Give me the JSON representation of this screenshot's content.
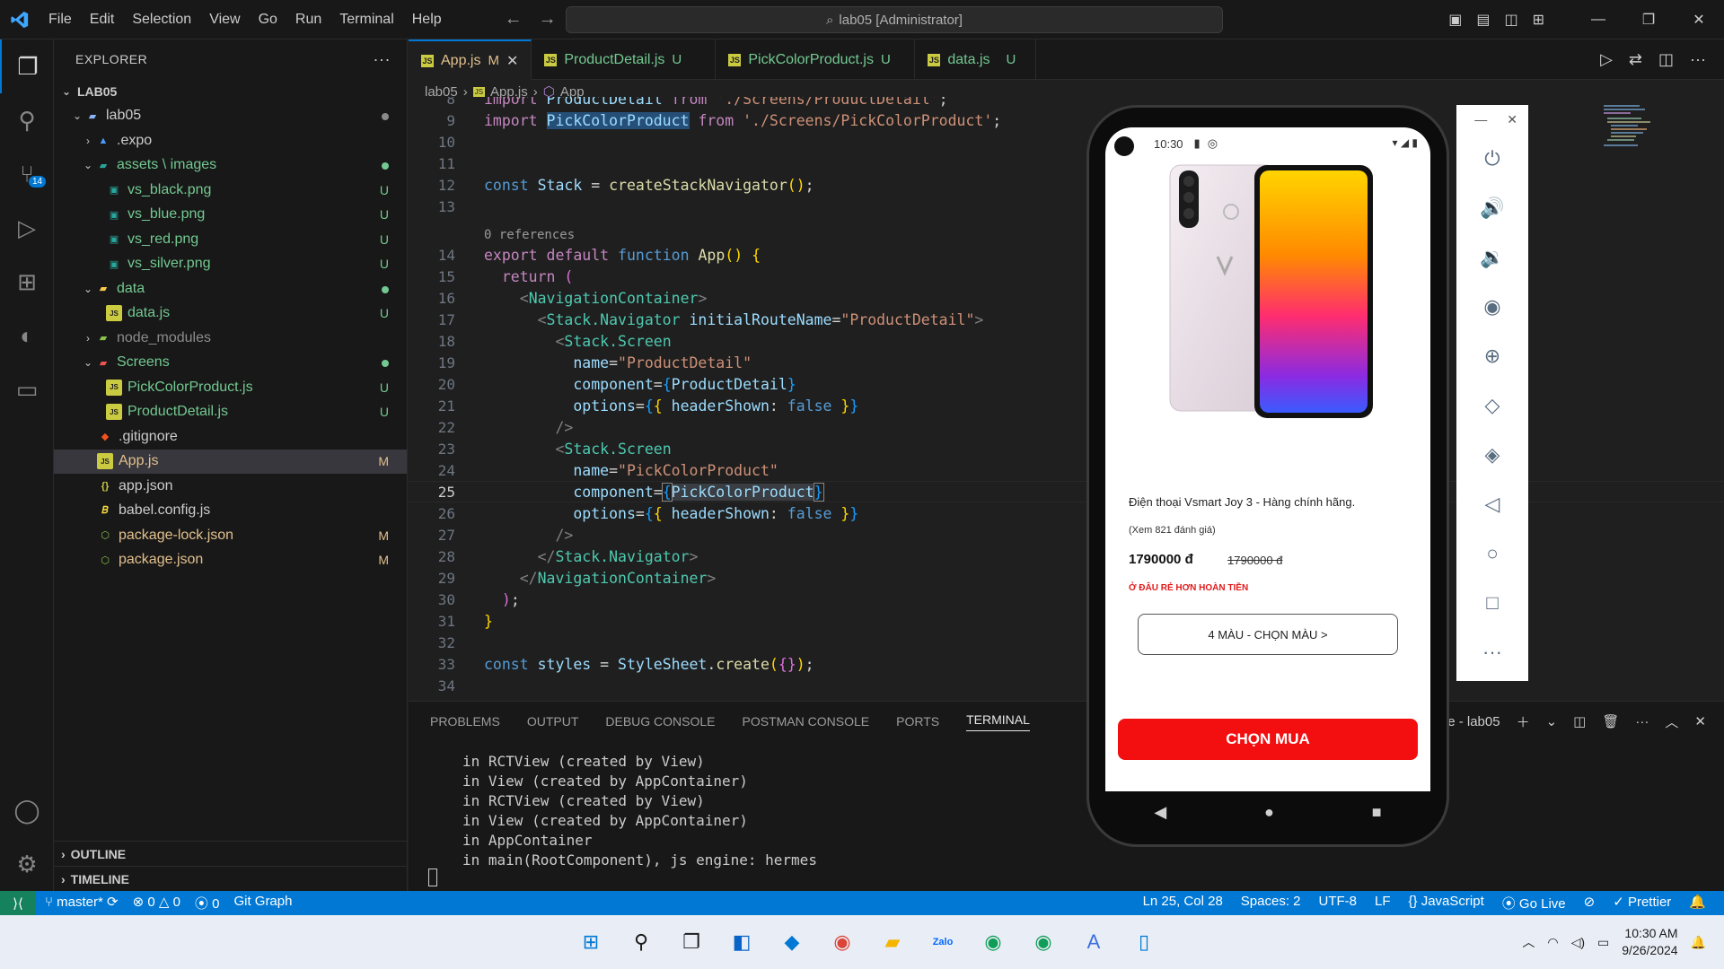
{
  "titlebar": {
    "menu": [
      "File",
      "Edit",
      "Selection",
      "View",
      "Go",
      "Run",
      "Terminal",
      "Help"
    ],
    "search": "lab05 [Administrator]"
  },
  "activity": {
    "scm_badge": "14"
  },
  "sidebar": {
    "title": "EXPLORER",
    "root": "LAB05",
    "items": [
      {
        "label": "lab05",
        "status": "dot"
      },
      {
        "label": ".expo",
        "status": ""
      },
      {
        "label": "assets \\ images",
        "status": "dot"
      },
      {
        "label": "vs_black.png",
        "status": "U"
      },
      {
        "label": "vs_blue.png",
        "status": "U"
      },
      {
        "label": "vs_red.png",
        "status": "U"
      },
      {
        "label": "vs_silver.png",
        "status": "U"
      },
      {
        "label": "data",
        "status": "dot"
      },
      {
        "label": "data.js",
        "status": "U"
      },
      {
        "label": "node_modules",
        "status": ""
      },
      {
        "label": "Screens",
        "status": "dot"
      },
      {
        "label": "PickColorProduct.js",
        "status": "U"
      },
      {
        "label": "ProductDetail.js",
        "status": "U"
      },
      {
        "label": ".gitignore",
        "status": ""
      },
      {
        "label": "App.js",
        "status": "M"
      },
      {
        "label": "app.json",
        "status": ""
      },
      {
        "label": "babel.config.js",
        "status": ""
      },
      {
        "label": "package-lock.json",
        "status": "M"
      },
      {
        "label": "package.json",
        "status": "M"
      }
    ],
    "outline": "OUTLINE",
    "timeline": "TIMELINE"
  },
  "tabs": [
    {
      "label": "App.js",
      "mod": "M"
    },
    {
      "label": "ProductDetail.js",
      "mod": "U"
    },
    {
      "label": "PickColorProduct.js",
      "mod": "U"
    },
    {
      "label": "data.js",
      "mod": "U"
    }
  ],
  "breadcrumb": [
    "lab05",
    "App.js",
    "App"
  ],
  "code": {
    "line8": "import ProductDetail from './Screens/ProductDetail';",
    "refs": "0 references",
    "lines": [
      "8",
      "9",
      "10",
      "11",
      "12",
      "13",
      "14",
      "15",
      "16",
      "17",
      "18",
      "19",
      "20",
      "21",
      "22",
      "23",
      "24",
      "25",
      "26",
      "27",
      "28",
      "29",
      "30",
      "31",
      "32",
      "33",
      "34"
    ]
  },
  "panel": {
    "tabs": [
      "PROBLEMS",
      "OUTPUT",
      "DEBUG CONSOLE",
      "POSTMAN CONSOLE",
      "PORTS",
      "TERMINAL"
    ],
    "terminal_name": "node - lab05",
    "terminal_lines": [
      "in RCTView (created by View)",
      "in View (created by AppContainer)",
      "in RCTView (created by View)",
      "in View (created by AppContainer)",
      "in AppContainer",
      "in main(RootComponent), js engine: hermes"
    ]
  },
  "statusbar": {
    "branch": "master*",
    "errors": "0",
    "warnings": "0",
    "ports": "0",
    "gitgraph": "Git Graph",
    "position": "Ln 25, Col 28",
    "spaces": "Spaces: 2",
    "encoding": "UTF-8",
    "eol": "LF",
    "language": "JavaScript",
    "golive": "Go Live",
    "prettier": "Prettier"
  },
  "phone": {
    "time": "10:30",
    "name": "Điện thoại Vsmart Joy 3 - Hàng chính hãng.",
    "reviews": "(Xem 821 đánh giá)",
    "price": "1790000 đ",
    "old_price": "1790000 đ",
    "refund": "Ở ĐÂU RẺ HƠN HOÀN TIỀN",
    "color_btn": "4 MÀU - CHỌN MÀU >",
    "buy_btn": "CHỌN MUA"
  },
  "taskbar": {
    "time": "10:30 AM",
    "date": "9/26/2024"
  }
}
